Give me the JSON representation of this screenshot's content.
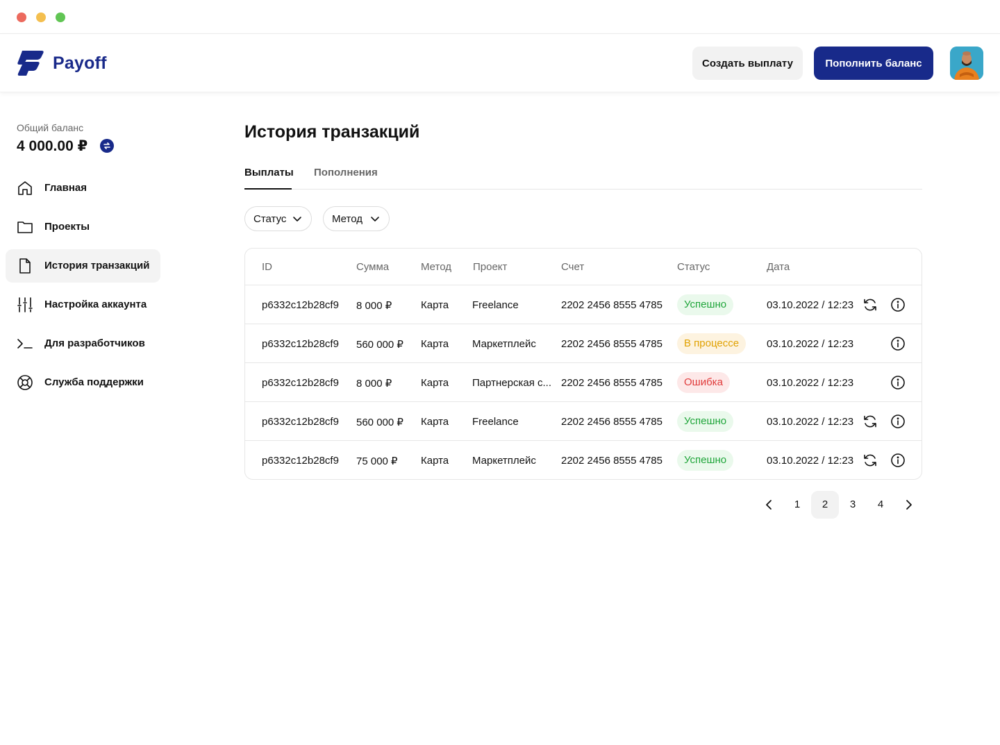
{
  "header": {
    "brand": "Payoff",
    "create_payout": "Создать выплату",
    "top_up": "Пополнить баланс"
  },
  "sidebar": {
    "balance_label": "Общий баланс",
    "balance_value": "4 000.00 ₽",
    "items": [
      {
        "label": "Главная",
        "icon": "home-icon",
        "active": false
      },
      {
        "label": "Проекты",
        "icon": "folder-icon",
        "active": false
      },
      {
        "label": "История транзакций",
        "icon": "document-icon",
        "active": true
      },
      {
        "label": "Настройка аккаунта",
        "icon": "sliders-icon",
        "active": false
      },
      {
        "label": "Для разработчиков",
        "icon": "terminal-icon",
        "active": false
      },
      {
        "label": "Служба поддержки",
        "icon": "lifebuoy-icon",
        "active": false
      }
    ]
  },
  "main": {
    "title": "История транзакций",
    "tabs": [
      {
        "label": "Выплаты",
        "active": true
      },
      {
        "label": "Пополнения",
        "active": false
      }
    ],
    "filters": [
      {
        "label": "Статус"
      },
      {
        "label": "Метод"
      }
    ],
    "table": {
      "columns": [
        "ID",
        "Сумма",
        "Метод",
        "Проект",
        "Счет",
        "Статус",
        "Дата"
      ],
      "rows": [
        {
          "id": "p6332c12b28cf9",
          "amount": "8 000 ₽",
          "method": "Карта",
          "project": "Freelance",
          "account": "2202 2456 8555 4785",
          "status": "Успешно",
          "status_type": "success",
          "date": "03.10.2022 / 12:23",
          "retry": true
        },
        {
          "id": "p6332c12b28cf9",
          "amount": "560 000 ₽",
          "method": "Карта",
          "project": "Маркетплейс",
          "account": "2202 2456 8555 4785",
          "status": "В процессе",
          "status_type": "progress",
          "date": "03.10.2022 / 12:23",
          "retry": false
        },
        {
          "id": "p6332c12b28cf9",
          "amount": "8 000 ₽",
          "method": "Карта",
          "project": "Партнерская с...",
          "account": "2202 2456 8555 4785",
          "status": "Ошибка",
          "status_type": "error",
          "date": "03.10.2022 / 12:23",
          "retry": false
        },
        {
          "id": "p6332c12b28cf9",
          "amount": "560 000 ₽",
          "method": "Карта",
          "project": "Freelance",
          "account": "2202 2456 8555 4785",
          "status": "Успешно",
          "status_type": "success",
          "date": "03.10.2022 / 12:23",
          "retry": true
        },
        {
          "id": "p6332c12b28cf9",
          "amount": "75 000 ₽",
          "method": "Карта",
          "project": "Маркетплейс",
          "account": "2202 2456 8555 4785",
          "status": "Успешно",
          "status_type": "success",
          "date": "03.10.2022 / 12:23",
          "retry": true
        }
      ]
    },
    "pagination": {
      "pages": [
        "1",
        "2",
        "3",
        "4"
      ],
      "current": "2"
    }
  },
  "colors": {
    "brand": "#182a8a",
    "success": "#1fa53a",
    "progress": "#e0a100",
    "error": "#e03a3a"
  }
}
